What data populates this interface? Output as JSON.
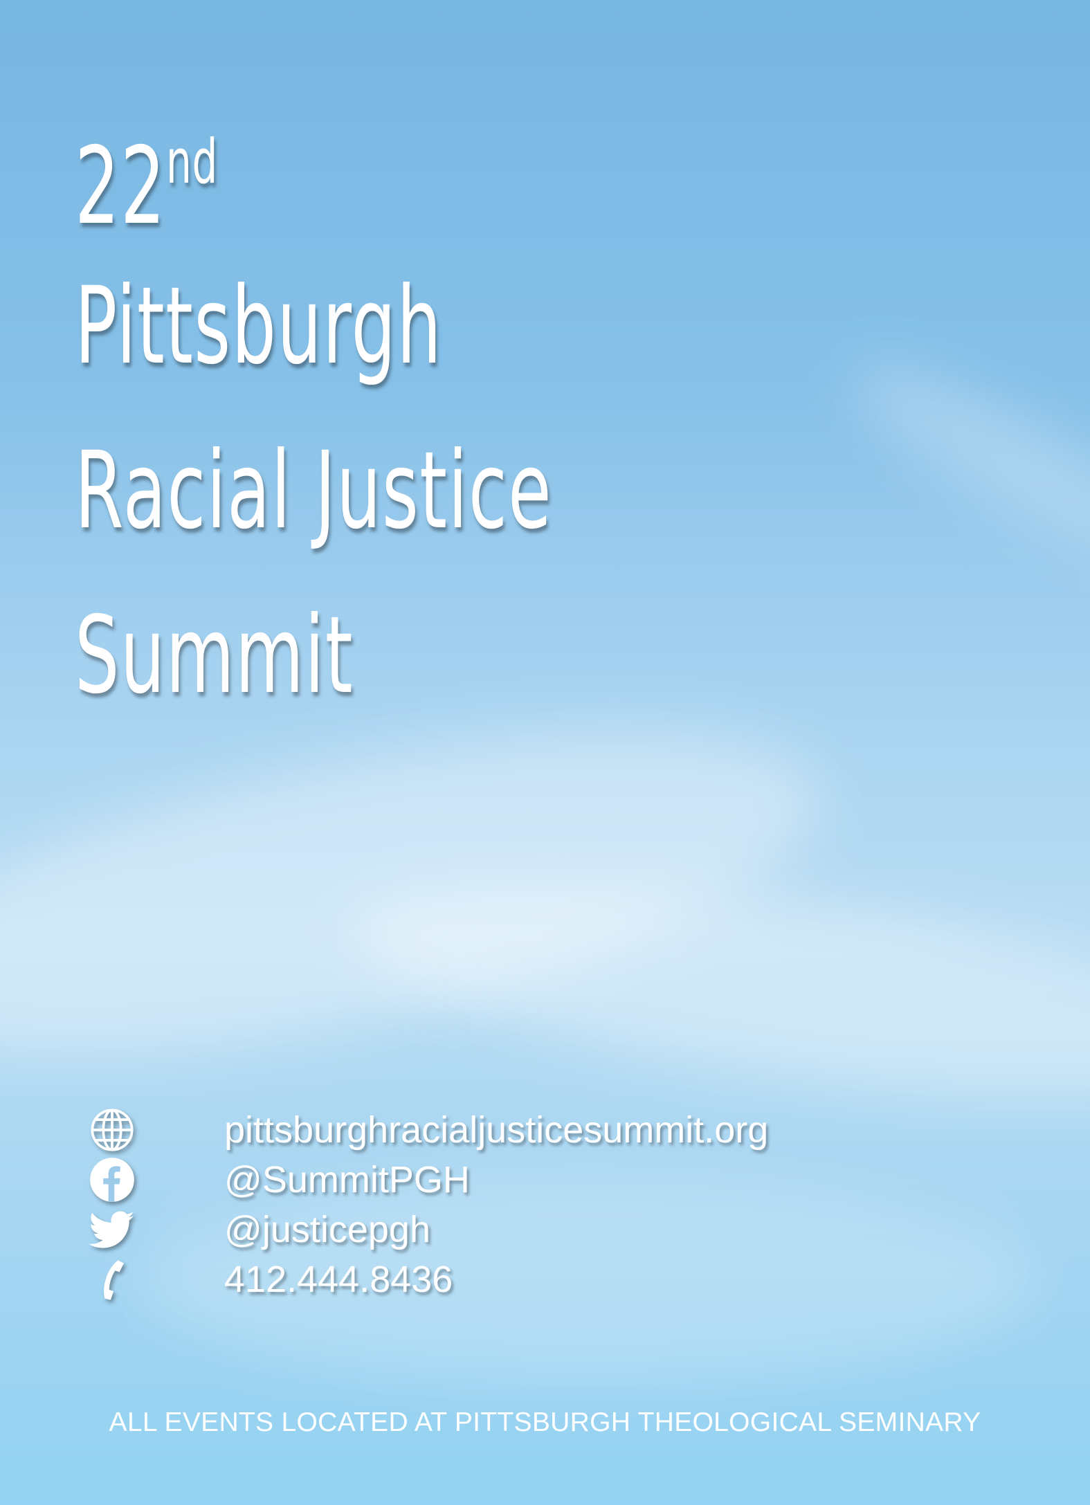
{
  "colors": {
    "sky_top": "#78b7e2",
    "sky_bottom": "#93d2f2",
    "text": "#ffffff"
  },
  "title": {
    "ordinal_number": "22",
    "ordinal_suffix": "nd",
    "line2": "Pittsburgh",
    "line3": "Racial Justice",
    "line4": "Summit"
  },
  "contacts": [
    {
      "icon": "globe-icon",
      "text": "pittsburghracialjusticesummit.org"
    },
    {
      "icon": "facebook-icon",
      "text": "@SummitPGH"
    },
    {
      "icon": "twitter-icon",
      "text": "@justicepgh"
    },
    {
      "icon": "phone-icon",
      "text": "412.444.8436"
    }
  ],
  "footer": "ALL EVENTS LOCATED AT PITTSBURGH THEOLOGICAL SEMINARY"
}
